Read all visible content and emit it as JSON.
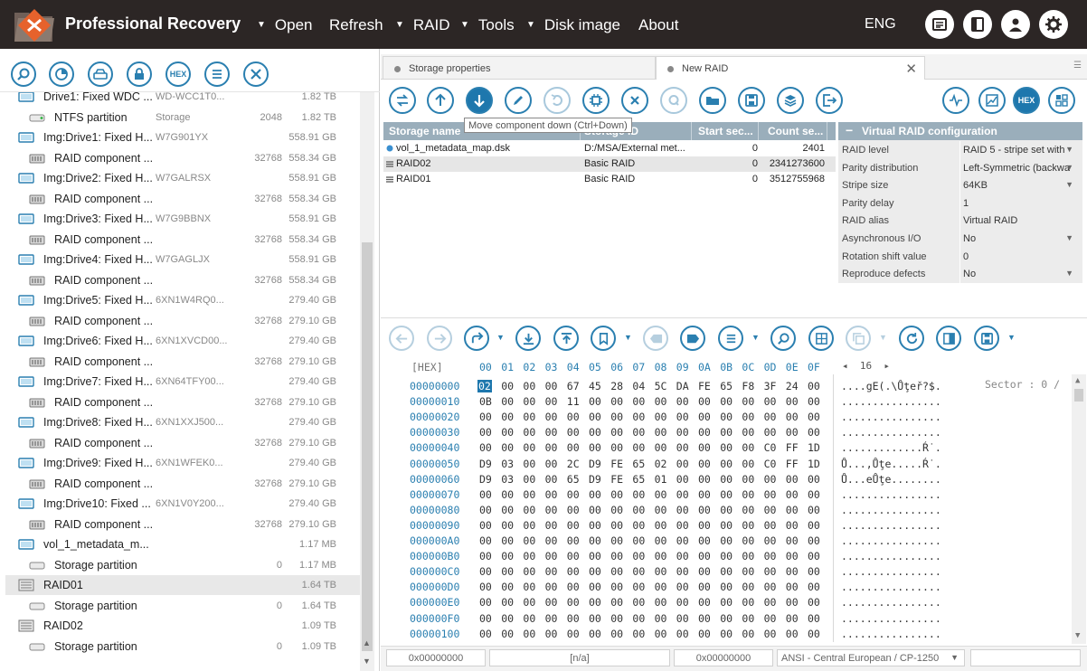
{
  "app": {
    "title": "Professional Recovery",
    "language": "ENG"
  },
  "menu": [
    {
      "label": "Open",
      "has_arrow": true
    },
    {
      "label": "Refresh",
      "has_arrow": false
    },
    {
      "label": "RAID",
      "has_arrow": true
    },
    {
      "label": "Tools",
      "has_arrow": true
    },
    {
      "label": "Disk image",
      "has_arrow": true
    },
    {
      "label": "About",
      "has_arrow": false
    }
  ],
  "top_buttons": [
    "news-icon",
    "panel-toggle-icon",
    "user-icon",
    "settings-gear-icon"
  ],
  "left_toolbar": [
    "search-icon",
    "scan-icon",
    "drive-icon",
    "lock-icon",
    "hex-icon",
    "list-icon",
    "close-icon"
  ],
  "left_toolbar_hex_label": "HEX",
  "tree": [
    {
      "kind": "drive",
      "name": "Drive1: Fixed WDC ...",
      "info": "WD-WCC1T0...",
      "num": "",
      "size": "1.82 TB",
      "indent": 1
    },
    {
      "kind": "ntfs",
      "name": "NTFS partition",
      "info": "Storage",
      "num": "2048",
      "size": "1.82 TB",
      "indent": 2
    },
    {
      "kind": "img",
      "name": "Img:Drive1: Fixed H...",
      "info": "W7G901YX",
      "num": "",
      "size": "558.91 GB",
      "indent": 1
    },
    {
      "kind": "raid-comp",
      "name": "RAID component ...",
      "info": "",
      "num": "32768",
      "size": "558.34 GB",
      "indent": 2
    },
    {
      "kind": "img",
      "name": "Img:Drive2: Fixed H...",
      "info": "W7GALRSX",
      "num": "",
      "size": "558.91 GB",
      "indent": 1
    },
    {
      "kind": "raid-comp",
      "name": "RAID component ...",
      "info": "",
      "num": "32768",
      "size": "558.34 GB",
      "indent": 2
    },
    {
      "kind": "img",
      "name": "Img:Drive3: Fixed H...",
      "info": "W7G9BBNX",
      "num": "",
      "size": "558.91 GB",
      "indent": 1
    },
    {
      "kind": "raid-comp",
      "name": "RAID component ...",
      "info": "",
      "num": "32768",
      "size": "558.34 GB",
      "indent": 2
    },
    {
      "kind": "img",
      "name": "Img:Drive4: Fixed H...",
      "info": "W7GAGLJX",
      "num": "",
      "size": "558.91 GB",
      "indent": 1
    },
    {
      "kind": "raid-comp",
      "name": "RAID component ...",
      "info": "",
      "num": "32768",
      "size": "558.34 GB",
      "indent": 2
    },
    {
      "kind": "img",
      "name": "Img:Drive5: Fixed H...",
      "info": "6XN1W4RQ0...",
      "num": "",
      "size": "279.40 GB",
      "indent": 1
    },
    {
      "kind": "raid-comp",
      "name": "RAID component ...",
      "info": "",
      "num": "32768",
      "size": "279.10 GB",
      "indent": 2
    },
    {
      "kind": "img",
      "name": "Img:Drive6: Fixed H...",
      "info": "6XN1XVCD00...",
      "num": "",
      "size": "279.40 GB",
      "indent": 1
    },
    {
      "kind": "raid-comp",
      "name": "RAID component ...",
      "info": "",
      "num": "32768",
      "size": "279.10 GB",
      "indent": 2
    },
    {
      "kind": "img",
      "name": "Img:Drive7: Fixed H...",
      "info": "6XN64TFY00...",
      "num": "",
      "size": "279.40 GB",
      "indent": 1
    },
    {
      "kind": "raid-comp",
      "name": "RAID component ...",
      "info": "",
      "num": "32768",
      "size": "279.10 GB",
      "indent": 2
    },
    {
      "kind": "img",
      "name": "Img:Drive8: Fixed H...",
      "info": "6XN1XXJ500...",
      "num": "",
      "size": "279.40 GB",
      "indent": 1
    },
    {
      "kind": "raid-comp",
      "name": "RAID component ...",
      "info": "",
      "num": "32768",
      "size": "279.10 GB",
      "indent": 2
    },
    {
      "kind": "img",
      "name": "Img:Drive9: Fixed H...",
      "info": "6XN1WFEK0...",
      "num": "",
      "size": "279.40 GB",
      "indent": 1
    },
    {
      "kind": "raid-comp",
      "name": "RAID component ...",
      "info": "",
      "num": "32768",
      "size": "279.10 GB",
      "indent": 2
    },
    {
      "kind": "img",
      "name": "Img:Drive10: Fixed ...",
      "info": "6XN1V0Y200...",
      "num": "",
      "size": "279.40 GB",
      "indent": 1
    },
    {
      "kind": "raid-comp",
      "name": "RAID component ...",
      "info": "",
      "num": "32768",
      "size": "279.10 GB",
      "indent": 2
    },
    {
      "kind": "img",
      "name": "vol_1_metadata_m...",
      "info": "",
      "num": "",
      "size": "1.17 MB",
      "indent": 1
    },
    {
      "kind": "partition",
      "name": "Storage partition",
      "info": "",
      "num": "0",
      "size": "1.17 MB",
      "indent": 2
    },
    {
      "kind": "raid",
      "name": "RAID01",
      "info": "",
      "num": "",
      "size": "1.64 TB",
      "indent": 1,
      "selected": true
    },
    {
      "kind": "partition",
      "name": "Storage partition",
      "info": "",
      "num": "0",
      "size": "1.64 TB",
      "indent": 2
    },
    {
      "kind": "raid",
      "name": "RAID02",
      "info": "",
      "num": "",
      "size": "1.09 TB",
      "indent": 1
    },
    {
      "kind": "partition",
      "name": "Storage partition",
      "info": "",
      "num": "0",
      "size": "1.09 TB",
      "indent": 2
    }
  ],
  "tabs": [
    {
      "label": "Storage properties",
      "active": false
    },
    {
      "label": "New RAID",
      "active": true
    }
  ],
  "raid_toolbar": {
    "tooltip": "Move component down (Ctrl+Down)",
    "hex_label": "HEX"
  },
  "storage_table": {
    "columns": [
      "Storage name",
      "Storage ID",
      "Start sec...",
      "Count se..."
    ],
    "rows": [
      {
        "name": "vol_1_metadata_map.dsk",
        "id": "D:/MSA/External met...",
        "start": "0",
        "count": "2401",
        "icon": "dot"
      },
      {
        "name": "RAID02",
        "id": "Basic RAID",
        "start": "0",
        "count": "2341273600",
        "icon": "raid",
        "selected": true
      },
      {
        "name": "RAID01",
        "id": "Basic RAID",
        "start": "0",
        "count": "3512755968",
        "icon": "raid"
      }
    ]
  },
  "raid_config": {
    "title": "Virtual RAID configuration",
    "rows": [
      {
        "key": "RAID level",
        "value": "RAID 5 - stripe set with",
        "dropdown": true
      },
      {
        "key": "Parity distribution",
        "value": "Left-Symmetric (backwa",
        "dropdown": true
      },
      {
        "key": "Stripe size",
        "value": "64KB",
        "dropdown": true
      },
      {
        "key": "Parity delay",
        "value": "1",
        "dropdown": false
      },
      {
        "key": "RAID alias",
        "value": "Virtual RAID",
        "dropdown": false
      },
      {
        "key": "Asynchronous I/O",
        "value": "No",
        "dropdown": true
      },
      {
        "key": "Rotation shift value",
        "value": "0",
        "dropdown": false
      },
      {
        "key": "Reproduce defects",
        "value": "No",
        "dropdown": true
      }
    ]
  },
  "hex": {
    "header_label": "[HEX]",
    "columns": [
      "00",
      "01",
      "02",
      "03",
      "04",
      "05",
      "06",
      "07",
      "08",
      "09",
      "0A",
      "0B",
      "0C",
      "0D",
      "0E",
      "0F"
    ],
    "page_nav": "16",
    "sector_label": "Sector : 0 /",
    "rows": [
      {
        "offset": "00000000",
        "bytes": [
          "02",
          "00",
          "00",
          "00",
          "67",
          "45",
          "28",
          "04",
          "5C",
          "DA",
          "FE",
          "65",
          "F8",
          "3F",
          "24",
          "00"
        ],
        "ascii": "....gE(.\\Ůţeř?$."
      },
      {
        "offset": "00000010",
        "bytes": [
          "0B",
          "00",
          "00",
          "00",
          "11",
          "00",
          "00",
          "00",
          "00",
          "00",
          "00",
          "00",
          "00",
          "00",
          "00",
          "00"
        ],
        "ascii": "................"
      },
      {
        "offset": "00000020",
        "bytes": [
          "00",
          "00",
          "00",
          "00",
          "00",
          "00",
          "00",
          "00",
          "00",
          "00",
          "00",
          "00",
          "00",
          "00",
          "00",
          "00"
        ],
        "ascii": "................"
      },
      {
        "offset": "00000030",
        "bytes": [
          "00",
          "00",
          "00",
          "00",
          "00",
          "00",
          "00",
          "00",
          "00",
          "00",
          "00",
          "00",
          "00",
          "00",
          "00",
          "00"
        ],
        "ascii": "................"
      },
      {
        "offset": "00000040",
        "bytes": [
          "00",
          "00",
          "00",
          "00",
          "00",
          "00",
          "00",
          "00",
          "00",
          "00",
          "00",
          "00",
          "00",
          "C0",
          "FF",
          "1D"
        ],
        "ascii": ".............Ŕ˙."
      },
      {
        "offset": "00000050",
        "bytes": [
          "D9",
          "03",
          "00",
          "00",
          "2C",
          "D9",
          "FE",
          "65",
          "02",
          "00",
          "00",
          "00",
          "00",
          "C0",
          "FF",
          "1D"
        ],
        "ascii": "Ů...,Ůţe.....Ŕ˙."
      },
      {
        "offset": "00000060",
        "bytes": [
          "D9",
          "03",
          "00",
          "00",
          "65",
          "D9",
          "FE",
          "65",
          "01",
          "00",
          "00",
          "00",
          "00",
          "00",
          "00",
          "00"
        ],
        "ascii": "Ů...eŮţe........"
      },
      {
        "offset": "00000070",
        "bytes": [
          "00",
          "00",
          "00",
          "00",
          "00",
          "00",
          "00",
          "00",
          "00",
          "00",
          "00",
          "00",
          "00",
          "00",
          "00",
          "00"
        ],
        "ascii": "................"
      },
      {
        "offset": "00000080",
        "bytes": [
          "00",
          "00",
          "00",
          "00",
          "00",
          "00",
          "00",
          "00",
          "00",
          "00",
          "00",
          "00",
          "00",
          "00",
          "00",
          "00"
        ],
        "ascii": "................"
      },
      {
        "offset": "00000090",
        "bytes": [
          "00",
          "00",
          "00",
          "00",
          "00",
          "00",
          "00",
          "00",
          "00",
          "00",
          "00",
          "00",
          "00",
          "00",
          "00",
          "00"
        ],
        "ascii": "................"
      },
      {
        "offset": "000000A0",
        "bytes": [
          "00",
          "00",
          "00",
          "00",
          "00",
          "00",
          "00",
          "00",
          "00",
          "00",
          "00",
          "00",
          "00",
          "00",
          "00",
          "00"
        ],
        "ascii": "................"
      },
      {
        "offset": "000000B0",
        "bytes": [
          "00",
          "00",
          "00",
          "00",
          "00",
          "00",
          "00",
          "00",
          "00",
          "00",
          "00",
          "00",
          "00",
          "00",
          "00",
          "00"
        ],
        "ascii": "................"
      },
      {
        "offset": "000000C0",
        "bytes": [
          "00",
          "00",
          "00",
          "00",
          "00",
          "00",
          "00",
          "00",
          "00",
          "00",
          "00",
          "00",
          "00",
          "00",
          "00",
          "00"
        ],
        "ascii": "................"
      },
      {
        "offset": "000000D0",
        "bytes": [
          "00",
          "00",
          "00",
          "00",
          "00",
          "00",
          "00",
          "00",
          "00",
          "00",
          "00",
          "00",
          "00",
          "00",
          "00",
          "00"
        ],
        "ascii": "................"
      },
      {
        "offset": "000000E0",
        "bytes": [
          "00",
          "00",
          "00",
          "00",
          "00",
          "00",
          "00",
          "00",
          "00",
          "00",
          "00",
          "00",
          "00",
          "00",
          "00",
          "00"
        ],
        "ascii": "................"
      },
      {
        "offset": "000000F0",
        "bytes": [
          "00",
          "00",
          "00",
          "00",
          "00",
          "00",
          "00",
          "00",
          "00",
          "00",
          "00",
          "00",
          "00",
          "00",
          "00",
          "00"
        ],
        "ascii": "................"
      },
      {
        "offset": "00000100",
        "bytes": [
          "00",
          "00",
          "00",
          "00",
          "00",
          "00",
          "00",
          "00",
          "00",
          "00",
          "00",
          "00",
          "00",
          "00",
          "00",
          "00"
        ],
        "ascii": "................"
      }
    ]
  },
  "statusbar": {
    "offset": "0x00000000",
    "value": "[n/a]",
    "offset2": "0x00000000",
    "encoding": "ANSI - Central European / CP-1250"
  },
  "colors": {
    "accent": "#2a7fb0",
    "topbar": "#2c2625",
    "header": "#9aaebb"
  }
}
